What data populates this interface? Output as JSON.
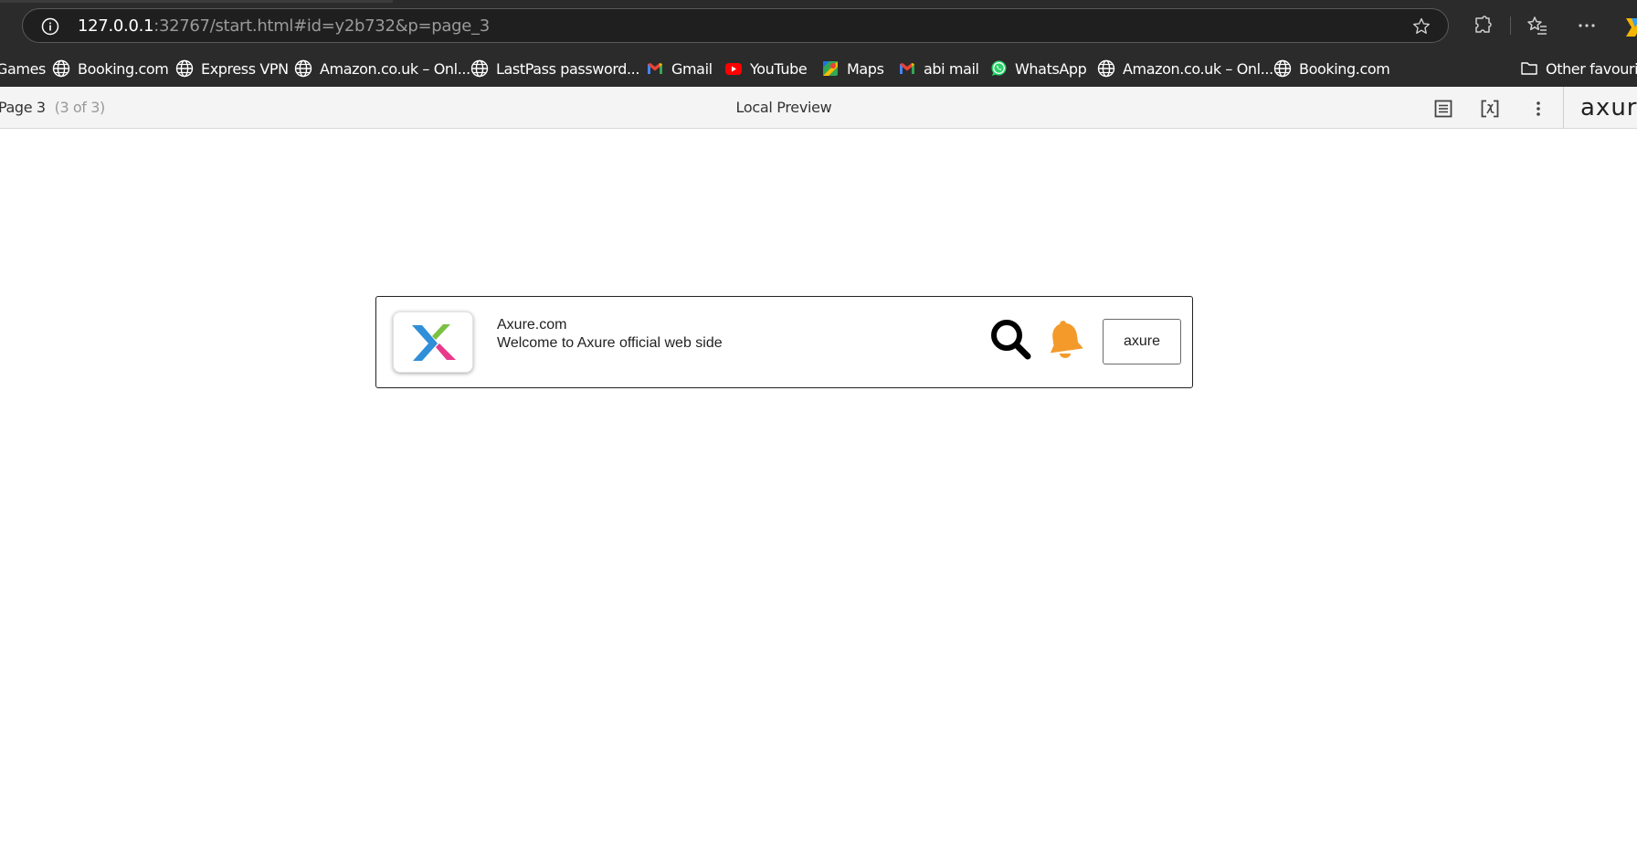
{
  "browser": {
    "url_host": "127.0.0.1",
    "url_rest": ":32767/start.html#id=y2b732&p=page_3",
    "toolbar_icons": [
      "info-icon",
      "star-icon",
      "extensions-icon",
      "favorites-icon",
      "more-icon",
      "copilot-icon"
    ]
  },
  "bookmarks": {
    "items": [
      {
        "label": "Games",
        "icon": "globe-icon"
      },
      {
        "label": "Booking.com",
        "icon": "globe-icon"
      },
      {
        "label": "Express VPN",
        "icon": "globe-icon"
      },
      {
        "label": "Amazon.co.uk – Onl...",
        "icon": "globe-icon"
      },
      {
        "label": "LastPass password...",
        "icon": "globe-icon"
      },
      {
        "label": "Gmail",
        "icon": "gmail-icon"
      },
      {
        "label": "YouTube",
        "icon": "youtube-icon"
      },
      {
        "label": "Maps",
        "icon": "maps-icon"
      },
      {
        "label": "abi mail",
        "icon": "gmail-icon"
      },
      {
        "label": "WhatsApp",
        "icon": "whatsapp-icon"
      },
      {
        "label": "Amazon.co.uk – Onl...",
        "icon": "globe-icon"
      },
      {
        "label": "Booking.com",
        "icon": "globe-icon"
      }
    ],
    "other_label": "Other favourites"
  },
  "axure_toolbar": {
    "page_label": "Page 3",
    "page_count": "(3 of 3)",
    "title": "Local Preview",
    "logo_text": "axure",
    "icons": [
      "notes-icon",
      "variables-icon",
      "more-vertical-icon"
    ]
  },
  "card": {
    "title": "Axure.com",
    "subtitle": "Welcome to Axure official web side",
    "button_label": "axure",
    "colors": {
      "bell": "#f39a2b",
      "logo_blue": "#2f8fd8",
      "logo_green": "#7ac143",
      "logo_pink": "#e8398b"
    }
  }
}
